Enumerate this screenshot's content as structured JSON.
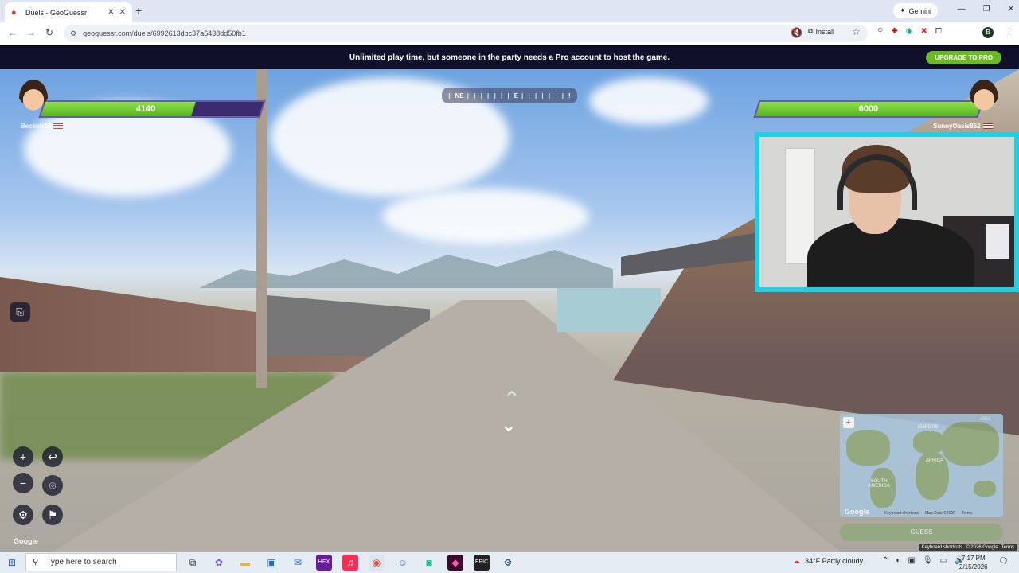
{
  "browser": {
    "tab_title": "Duels - GeoGuessr",
    "new_tab_symbol": "+",
    "url": "geoguessr.com/duels/6992613dbc37a6438dd50fb1",
    "install_label": "Install",
    "gemini_label": "Gemini",
    "profile_initial": "B"
  },
  "promo": {
    "message": "Unlimited play time, but someone in the party needs a Pro account to host the game.",
    "upgrade_label": "UPGRADE TO PRO"
  },
  "compass": {
    "left": "NE",
    "center": "E",
    "right": "!"
  },
  "player1": {
    "health": "4140",
    "health_fraction": 0.69,
    "name": "Beckett22"
  },
  "player2": {
    "health": "6000",
    "health_fraction": 1.0,
    "name": "SunnyOasis862"
  },
  "controls": {
    "zoom_in": "+",
    "zoom_out": "−",
    "undo": "↩",
    "checkpoint": "⌾",
    "settings": "⚙",
    "flag": "⚑",
    "report": "⎘"
  },
  "streetview": {
    "google_label": "Google",
    "footer": [
      "Keyboard shortcuts",
      "© 2026 Google",
      "Terms"
    ]
  },
  "minimap": {
    "labels": [
      "EUROPE",
      "ASIA",
      "AFRICA",
      "SOUTH AMERICA"
    ],
    "google_label": "Google",
    "footer": [
      "Keyboard shortcuts",
      "Map Data ©2020",
      "Terms"
    ],
    "guess_label": "GUESS"
  },
  "taskbar": {
    "search_placeholder": "Type here to search",
    "weather": "34°F  Partly cloudy",
    "time": "7:17 PM",
    "date": "2/15/2026",
    "apps": [
      "task-view",
      "copilot",
      "file-explorer",
      "store",
      "outlook",
      "hex",
      "music",
      "chrome",
      "discord",
      "app",
      "adobe",
      "epic",
      "steam"
    ]
  }
}
